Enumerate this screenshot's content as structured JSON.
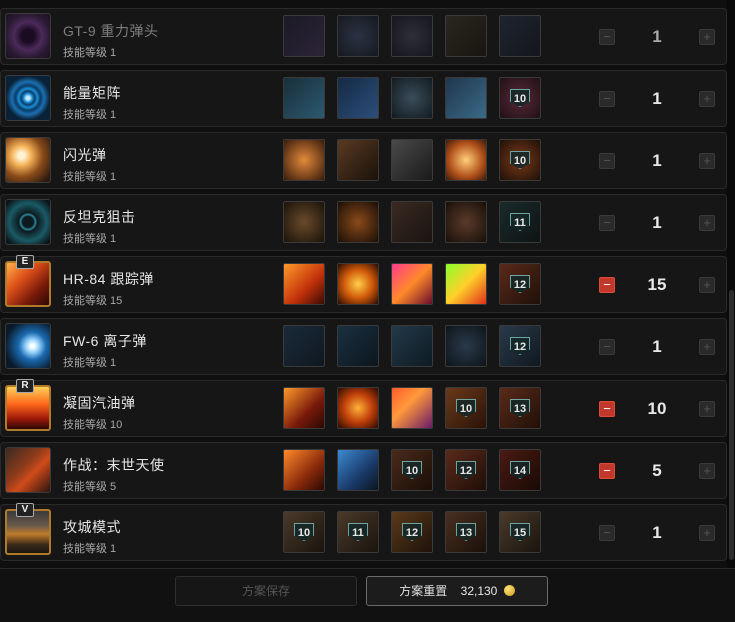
{
  "skills": [
    {
      "name": "GT-9 重力弹头",
      "level": "技能等级 1",
      "count": "1",
      "badge": "",
      "mods": [
        "",
        "",
        "",
        "",
        ""
      ],
      "icon": "purple-vortex-icon",
      "minus_active": false
    },
    {
      "name": "能量矩阵",
      "level": "技能等级 1",
      "count": "1",
      "badge": "",
      "mods": [
        "",
        "",
        "",
        "",
        "10"
      ],
      "icon": "energy-matrix-icon",
      "minus_active": false
    },
    {
      "name": "闪光弹",
      "level": "技能等级 1",
      "count": "1",
      "badge": "",
      "mods": [
        "",
        "",
        "",
        "",
        "10"
      ],
      "icon": "flash-grenade-icon",
      "minus_active": false
    },
    {
      "name": "反坦克狙击",
      "level": "技能等级 1",
      "count": "1",
      "badge": "",
      "mods": [
        "",
        "",
        "",
        "",
        "11"
      ],
      "icon": "anti-tank-sniper-icon",
      "minus_active": false
    },
    {
      "name": "HR-84 跟踪弹",
      "level": "技能等级 15",
      "count": "15",
      "badge": "E",
      "mods": [
        "",
        "",
        "",
        "",
        "12"
      ],
      "icon": "homing-missile-icon",
      "minus_active": true
    },
    {
      "name": "FW-6 离子弹",
      "level": "技能等级 1",
      "count": "1",
      "badge": "",
      "mods": [
        "",
        "",
        "",
        "",
        "12"
      ],
      "icon": "ion-bomb-icon",
      "minus_active": false
    },
    {
      "name": "凝固汽油弹",
      "level": "技能等级 10",
      "count": "10",
      "badge": "R",
      "mods": [
        "",
        "",
        "",
        "10",
        "13"
      ],
      "icon": "napalm-icon",
      "minus_active": true
    },
    {
      "name": "作战：末世天使",
      "level": "技能等级 5",
      "count": "5",
      "badge": "",
      "mods": [
        "",
        "",
        "10",
        "12",
        "14"
      ],
      "icon": "doomsday-angel-icon",
      "minus_active": true
    },
    {
      "name": "攻城模式",
      "level": "技能等级 1",
      "count": "1",
      "badge": "V",
      "mods": [
        "10",
        "11",
        "12",
        "13",
        "15"
      ],
      "icon": "siege-mode-icon",
      "minus_active": false
    }
  ],
  "footer": {
    "save_label": "方案保存",
    "reset_label": "方案重置",
    "reset_cost": "32,130"
  },
  "colors": {
    "minus_active": "#c2382a",
    "gold_border": "#b07a2a"
  }
}
